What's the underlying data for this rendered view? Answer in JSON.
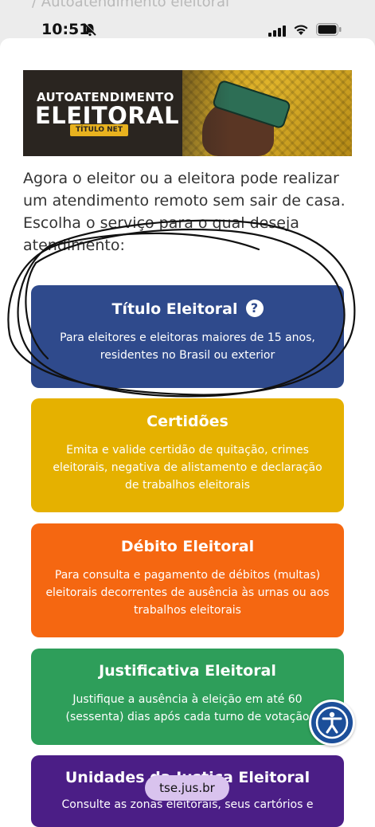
{
  "background_crumb": "/ Autoatendimento eleitoral",
  "status_bar": {
    "time": "10:51"
  },
  "banner": {
    "line1": "AUTOATENDIMENTO",
    "line2": "ELEITORAL",
    "badge": "TÍTULO NET"
  },
  "intro_text": "Agora o eleitor ou a eleitora pode realizar um atendimento remoto sem sair de casa. Escolha o serviço para o qual deseja atendimento:",
  "cards": [
    {
      "title": "Título Eleitoral",
      "desc": "Para eleitores e eleitoras maiores de 15 anos, residentes no Brasil ou exterior",
      "color": "#2f4a8c"
    },
    {
      "title": "Certidões",
      "desc": "Emita e valide certidão de quitação, crimes eleitorais, negativa de alistamento e declaração de trabalhos eleitorais",
      "color": "#e5b100"
    },
    {
      "title": "Débito Eleitoral",
      "desc": "Para consulta e pagamento de débitos (multas) eleitorais decorrentes de ausência às urnas ou aos trabalhos eleitorais",
      "color": "#f56711"
    },
    {
      "title": "Justificativa Eleitoral",
      "desc": "Justifique a ausência à eleição em até 60 (sessenta) dias após cada turno de votação",
      "color": "#2e9e5a"
    },
    {
      "title": "Unidades da Justiça Eleitoral",
      "desc": "Consulte as zonas eleitorais, seus cartórios e",
      "color": "#4b1e86"
    }
  ],
  "help_icon": "?",
  "url": "tse.jus.br",
  "icons": [
    "bell-muted-icon",
    "signal-icon",
    "wifi-icon",
    "battery-icon",
    "help-icon",
    "accessibility-icon"
  ]
}
